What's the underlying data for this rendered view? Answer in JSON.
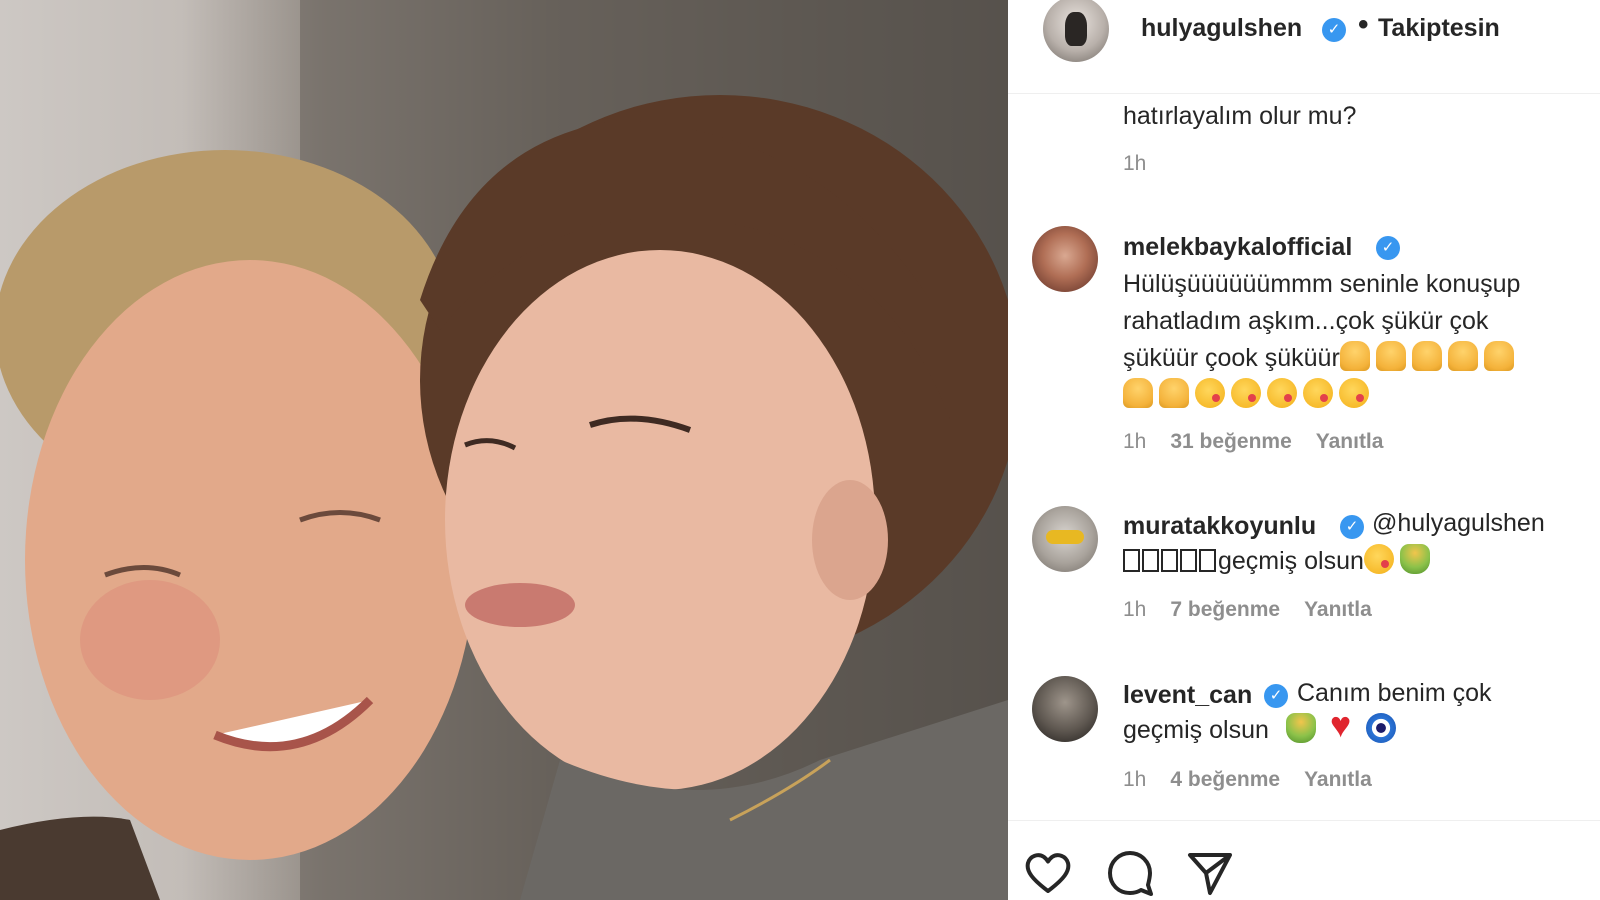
{
  "post": {
    "username": "hulyagulshen",
    "separator": "•",
    "follow_status": "Takiptesin"
  },
  "icons": {
    "verified": "verified-badge-icon",
    "like": "heart-icon",
    "comment": "comment-icon",
    "share": "share-icon"
  },
  "colors": {
    "verified": "#3897f0",
    "meta_text": "#8e8e8e",
    "text": "#262626"
  },
  "partial_comment": {
    "text": "hatırlayalım olur mu?",
    "time": "1h"
  },
  "comments": [
    {
      "username": "melekbaykalofficial",
      "text_line1": "Hülüşüüüüüümmm seninle konuşup",
      "text_line2": "rahatladım aşkım...çok şükür çok",
      "text_line3": "şüküür çook şüküür",
      "emoji_line3": [
        "pray",
        "pray",
        "pray",
        "pray",
        "pray"
      ],
      "emoji_line4": [
        "pray",
        "pray",
        "kiss",
        "kiss",
        "kiss",
        "kiss",
        "kiss"
      ],
      "time": "1h",
      "likes": "31 beğenme",
      "reply": "Yanıtla"
    },
    {
      "username": "muratakkoyunlu",
      "mention": "@hulyagulshen",
      "text": "geçmiş olsun",
      "time": "1h",
      "likes": "7 beğenme",
      "reply": "Yanıtla"
    },
    {
      "username": "levent_can",
      "text_line1": "Canım benim çok",
      "text_line2": "geçmiş olsun",
      "time": "1h",
      "likes": "4 beğenme",
      "reply": "Yanıtla"
    }
  ]
}
